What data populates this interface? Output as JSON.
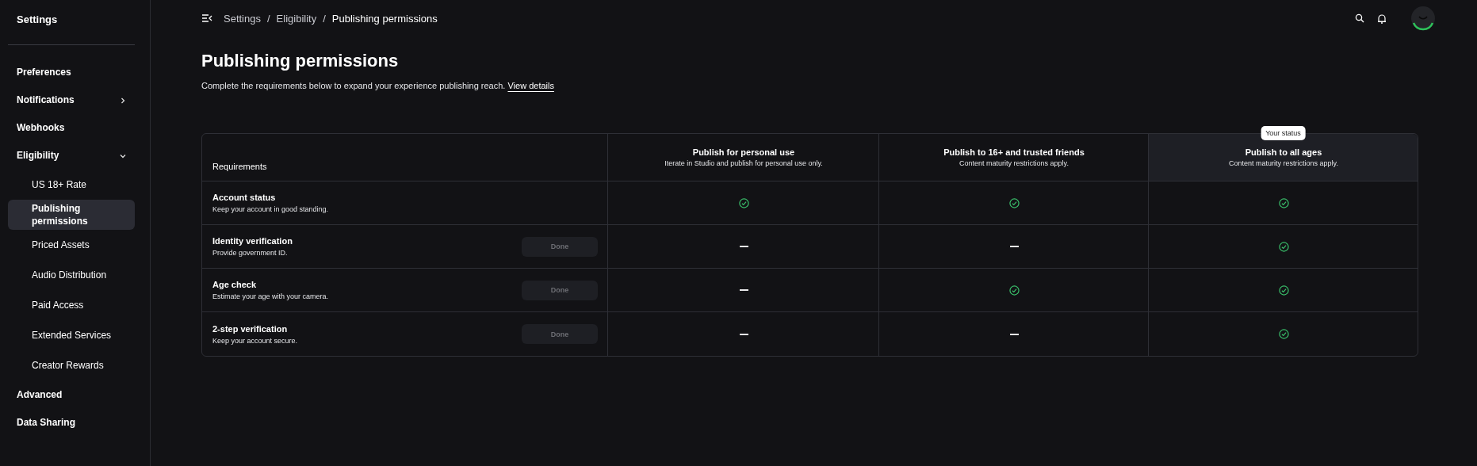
{
  "sidebar": {
    "title": "Settings",
    "items": [
      {
        "label": "Preferences",
        "selected": false
      },
      {
        "label": "Notifications",
        "selected": false,
        "expanded": false
      },
      {
        "label": "Webhooks",
        "selected": false
      },
      {
        "label": "Eligibility",
        "selected": false,
        "expanded": true,
        "children": [
          {
            "label": "US 18+ Rate",
            "selected": false
          },
          {
            "label": "Publishing permissions",
            "selected": true
          },
          {
            "label": "Priced Assets",
            "selected": false
          },
          {
            "label": "Audio Distribution",
            "selected": false
          },
          {
            "label": "Paid Access",
            "selected": false
          },
          {
            "label": "Extended Services",
            "selected": false
          },
          {
            "label": "Creator Rewards",
            "selected": false
          }
        ]
      },
      {
        "label": "Advanced",
        "selected": false
      },
      {
        "label": "Data Sharing",
        "selected": false
      }
    ]
  },
  "breadcrumb": {
    "separator": "/",
    "items": [
      "Settings",
      "Eligibility",
      "Publishing permissions"
    ]
  },
  "page": {
    "title": "Publishing permissions",
    "description": "Complete the requirements below to expand your experience publishing reach.",
    "link": "View details"
  },
  "table": {
    "requirements_heading": "Requirements",
    "columns": [
      {
        "title": "Publish for personal use",
        "subtitle": "Iterate in Studio and publish for personal use only.",
        "current": false
      },
      {
        "title": "Publish to 16+ and trusted friends",
        "subtitle": "Content maturity restrictions apply.",
        "current": false
      },
      {
        "title": "Publish to all ages",
        "subtitle": "Content maturity restrictions apply.",
        "current": true,
        "badge": "Your status"
      }
    ],
    "rows": [
      {
        "title": "Account status",
        "subtitle": "Keep your account in good standing.",
        "cells": [
          {
            "met": true
          },
          {
            "met": true
          },
          {
            "met": true
          }
        ]
      },
      {
        "title": "Identity verification",
        "subtitle": "Provide government ID.",
        "button": {
          "label": "Done",
          "disabled": true
        },
        "cells": [
          {
            "met": false
          },
          {
            "met": false
          },
          {
            "met": true
          }
        ]
      },
      {
        "title": "Age check",
        "subtitle": "Estimate your age with your camera.",
        "button": {
          "label": "Done",
          "disabled": true
        },
        "cells": [
          {
            "met": false
          },
          {
            "met": true
          },
          {
            "met": true
          }
        ]
      },
      {
        "title": "2-step verification",
        "subtitle": "Keep your account secure.",
        "button": {
          "label": "Done",
          "disabled": true
        },
        "cells": [
          {
            "met": false
          },
          {
            "met": false
          },
          {
            "met": true
          }
        ]
      }
    ]
  }
}
